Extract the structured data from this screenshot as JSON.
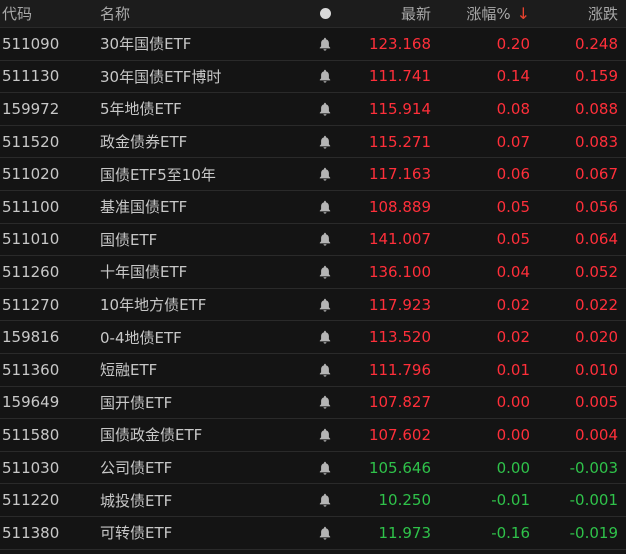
{
  "header": {
    "code": "代码",
    "name": "名称",
    "last": "最新",
    "pct": "涨幅%",
    "sort_arrow": "↓",
    "change": "涨跌"
  },
  "colors": {
    "up": "#ff2f3a",
    "down": "#2fc24a",
    "background": "#141414"
  },
  "icons": {
    "alert": "bell-icon",
    "header": "dot-icon",
    "sort": "arrow-down-icon"
  },
  "rows": [
    {
      "code": "511090",
      "name": "30年国债ETF",
      "last": "123.168",
      "pct": "0.20",
      "chg": "0.248",
      "dir": "up"
    },
    {
      "code": "511130",
      "name": "30年国债ETF博时",
      "last": "111.741",
      "pct": "0.14",
      "chg": "0.159",
      "dir": "up"
    },
    {
      "code": "159972",
      "name": "5年地债ETF",
      "last": "115.914",
      "pct": "0.08",
      "chg": "0.088",
      "dir": "up"
    },
    {
      "code": "511520",
      "name": "政金债券ETF",
      "last": "115.271",
      "pct": "0.07",
      "chg": "0.083",
      "dir": "up"
    },
    {
      "code": "511020",
      "name": "国债ETF5至10年",
      "last": "117.163",
      "pct": "0.06",
      "chg": "0.067",
      "dir": "up"
    },
    {
      "code": "511100",
      "name": "基准国债ETF",
      "last": "108.889",
      "pct": "0.05",
      "chg": "0.056",
      "dir": "up"
    },
    {
      "code": "511010",
      "name": "国债ETF",
      "last": "141.007",
      "pct": "0.05",
      "chg": "0.064",
      "dir": "up"
    },
    {
      "code": "511260",
      "name": "十年国债ETF",
      "last": "136.100",
      "pct": "0.04",
      "chg": "0.052",
      "dir": "up"
    },
    {
      "code": "511270",
      "name": "10年地方债ETF",
      "last": "117.923",
      "pct": "0.02",
      "chg": "0.022",
      "dir": "up"
    },
    {
      "code": "159816",
      "name": "0-4地债ETF",
      "last": "113.520",
      "pct": "0.02",
      "chg": "0.020",
      "dir": "up"
    },
    {
      "code": "511360",
      "name": "短融ETF",
      "last": "111.796",
      "pct": "0.01",
      "chg": "0.010",
      "dir": "up"
    },
    {
      "code": "159649",
      "name": "国开债ETF",
      "last": "107.827",
      "pct": "0.00",
      "chg": "0.005",
      "dir": "up"
    },
    {
      "code": "511580",
      "name": "国债政金债ETF",
      "last": "107.602",
      "pct": "0.00",
      "chg": "0.004",
      "dir": "up"
    },
    {
      "code": "511030",
      "name": "公司债ETF",
      "last": "105.646",
      "pct": "0.00",
      "chg": "-0.003",
      "dir": "down"
    },
    {
      "code": "511220",
      "name": "城投债ETF",
      "last": "10.250",
      "pct": "-0.01",
      "chg": "-0.001",
      "dir": "down"
    },
    {
      "code": "511380",
      "name": "可转债ETF",
      "last": "11.973",
      "pct": "-0.16",
      "chg": "-0.019",
      "dir": "down"
    }
  ]
}
